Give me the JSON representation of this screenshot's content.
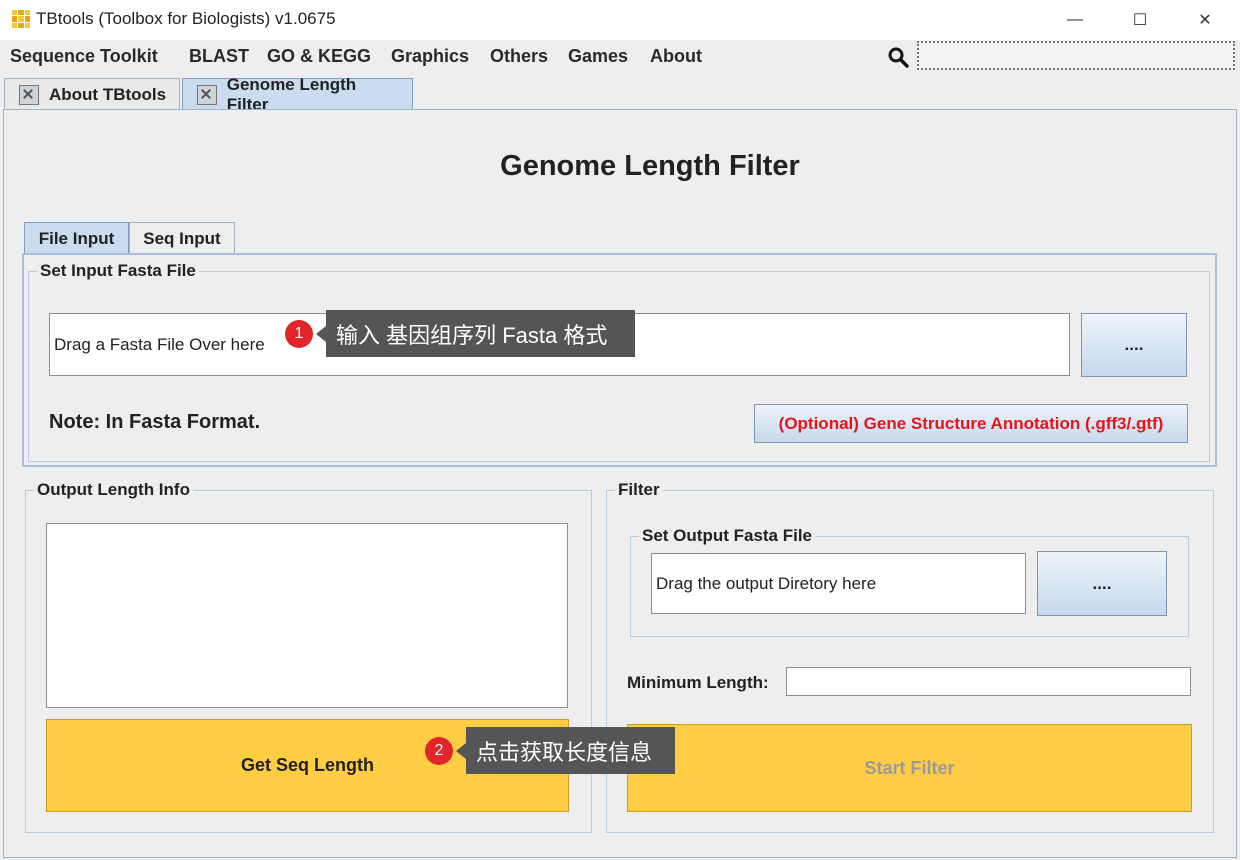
{
  "window": {
    "title": "TBtools (Toolbox for Biologists) v1.0675",
    "minimize": "—",
    "maximize": "☐",
    "close": "✕"
  },
  "menu": [
    "Sequence Toolkit",
    "BLAST",
    "GO & KEGG",
    "Graphics",
    "Others",
    "Games",
    "About"
  ],
  "search": {
    "icon": "search-icon",
    "value": ""
  },
  "tabs": [
    {
      "label": "About TBtools",
      "active": false
    },
    {
      "label": "Genome Length Filter",
      "active": true
    }
  ],
  "page_title": "Genome Length Filter",
  "input_tabs": [
    {
      "label": "File Input",
      "active": true
    },
    {
      "label": "Seq Input",
      "active": false
    }
  ],
  "input_group": {
    "legend": "Set Input Fasta File",
    "fasta_field": "Drag a Fasta File Over here",
    "browse": "....",
    "note": "Note: In Fasta Format.",
    "annotation_button": "(Optional) Gene Structure Annotation (.gff3/.gtf)"
  },
  "output_group": {
    "legend": "Output Length Info",
    "text": "",
    "button": "Get Seq Length"
  },
  "filter_group": {
    "legend": "Filter",
    "output_legend": "Set Output Fasta File",
    "output_field": "Drag the output Diretory here",
    "browse": "....",
    "min_label": "Minimum Length:",
    "min_value": "",
    "start_button": "Start Filter"
  },
  "annotations": [
    {
      "num": "1",
      "text": "输入 基因组序列 Fasta 格式"
    },
    {
      "num": "2",
      "text": "点击获取长度信息"
    }
  ],
  "colors": {
    "accent_yellow": "#ffcd44",
    "tab_active": "#c9dcf0",
    "annotation_red": "#e8141b",
    "badge_red": "#e1252a",
    "callout_bg": "#555555"
  }
}
